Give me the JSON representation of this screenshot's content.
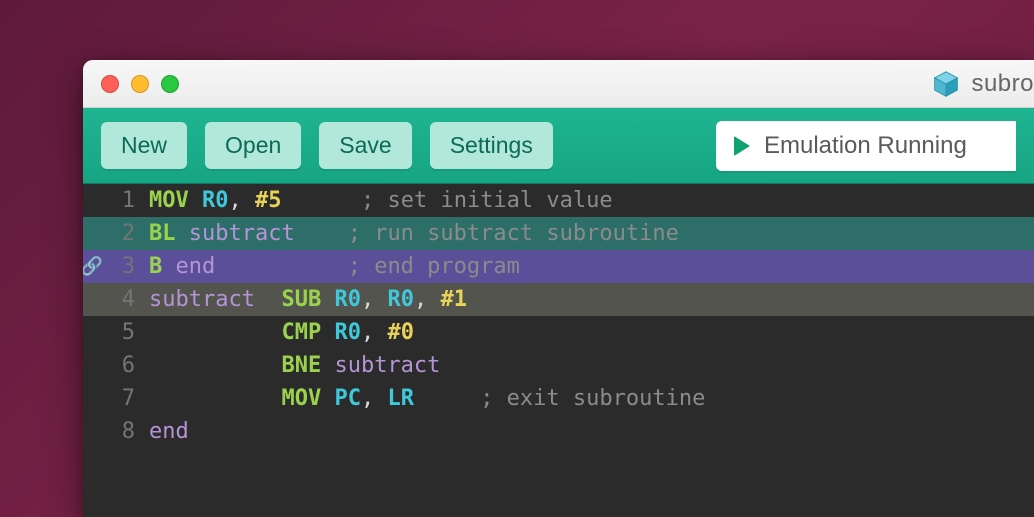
{
  "app": {
    "title": "subro"
  },
  "toolbar": {
    "new_label": "New",
    "open_label": "Open",
    "save_label": "Save",
    "settings_label": "Settings"
  },
  "emulation": {
    "status": "Emulation Running"
  },
  "code": {
    "lines": [
      {
        "n": 1,
        "highlight": null,
        "tokens": [
          {
            "cls": "tok-op",
            "text": "MOV"
          },
          {
            "cls": "tok-plain",
            "text": " "
          },
          {
            "cls": "tok-reg",
            "text": "R0"
          },
          {
            "cls": "tok-punc",
            "text": ", "
          },
          {
            "cls": "tok-imm",
            "text": "#5"
          },
          {
            "cls": "tok-plain",
            "text": "      "
          },
          {
            "cls": "tok-comm",
            "text": "; set initial value"
          }
        ]
      },
      {
        "n": 2,
        "highlight": "hl-teal",
        "tokens": [
          {
            "cls": "tok-op",
            "text": "BL"
          },
          {
            "cls": "tok-plain",
            "text": " "
          },
          {
            "cls": "tok-label",
            "text": "subtract"
          },
          {
            "cls": "tok-plain",
            "text": "    "
          },
          {
            "cls": "tok-comm",
            "text": "; run subtract subroutine"
          }
        ]
      },
      {
        "n": 3,
        "highlight": "hl-purple",
        "gutter_icon": "link-icon",
        "tokens": [
          {
            "cls": "tok-op",
            "text": "B"
          },
          {
            "cls": "tok-plain",
            "text": " "
          },
          {
            "cls": "tok-label",
            "text": "end"
          },
          {
            "cls": "tok-plain",
            "text": "          "
          },
          {
            "cls": "tok-comm",
            "text": "; end program"
          }
        ]
      },
      {
        "n": 4,
        "highlight": "hl-grey",
        "tokens": [
          {
            "cls": "tok-label",
            "text": "subtract"
          },
          {
            "cls": "tok-plain",
            "text": "  "
          },
          {
            "cls": "tok-op",
            "text": "SUB"
          },
          {
            "cls": "tok-plain",
            "text": " "
          },
          {
            "cls": "tok-reg",
            "text": "R0"
          },
          {
            "cls": "tok-punc",
            "text": ", "
          },
          {
            "cls": "tok-reg",
            "text": "R0"
          },
          {
            "cls": "tok-punc",
            "text": ", "
          },
          {
            "cls": "tok-imm",
            "text": "#1"
          }
        ]
      },
      {
        "n": 5,
        "highlight": null,
        "tokens": [
          {
            "cls": "tok-plain",
            "text": "          "
          },
          {
            "cls": "tok-op",
            "text": "CMP"
          },
          {
            "cls": "tok-plain",
            "text": " "
          },
          {
            "cls": "tok-reg",
            "text": "R0"
          },
          {
            "cls": "tok-punc",
            "text": ", "
          },
          {
            "cls": "tok-imm",
            "text": "#0"
          }
        ]
      },
      {
        "n": 6,
        "highlight": null,
        "tokens": [
          {
            "cls": "tok-plain",
            "text": "          "
          },
          {
            "cls": "tok-op",
            "text": "BNE"
          },
          {
            "cls": "tok-plain",
            "text": " "
          },
          {
            "cls": "tok-label",
            "text": "subtract"
          }
        ]
      },
      {
        "n": 7,
        "highlight": null,
        "tokens": [
          {
            "cls": "tok-plain",
            "text": "          "
          },
          {
            "cls": "tok-op",
            "text": "MOV"
          },
          {
            "cls": "tok-plain",
            "text": " "
          },
          {
            "cls": "tok-reg",
            "text": "PC"
          },
          {
            "cls": "tok-punc",
            "text": ", "
          },
          {
            "cls": "tok-reg",
            "text": "LR"
          },
          {
            "cls": "tok-plain",
            "text": "     "
          },
          {
            "cls": "tok-comm",
            "text": "; exit subroutine"
          }
        ]
      },
      {
        "n": 8,
        "highlight": null,
        "tokens": [
          {
            "cls": "tok-label",
            "text": "end"
          }
        ]
      }
    ]
  }
}
